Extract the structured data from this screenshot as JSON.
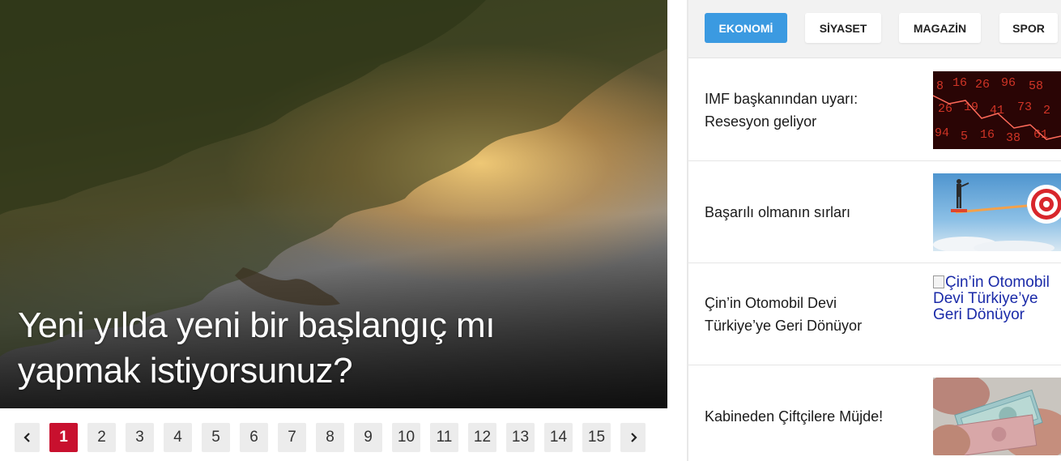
{
  "slider": {
    "headline": "Yeni yılda yeni bir başlangıç mı yapmak istiyorsunuz?",
    "pages": [
      "1",
      "2",
      "3",
      "4",
      "5",
      "6",
      "7",
      "8",
      "9",
      "10",
      "11",
      "12",
      "13",
      "14",
      "15"
    ],
    "active_page": "1",
    "prev_icon": "chevron-left-icon",
    "next_icon": "chevron-right-icon"
  },
  "tabs": [
    "EKONOMİ",
    "SİYASET",
    "MAGAZİN",
    "SPOR"
  ],
  "active_tab": "EKONOMİ",
  "news": [
    {
      "title": "IMF başkanından uyarı: Resesyon geliyor"
    },
    {
      "title": "Başarılı olmanın sırları"
    },
    {
      "title": "Çin’in Otomobil Devi Türkiye’ye Geri Dönüyor",
      "image_alt": "Çin’in Otomobil Devi Türkiye’ye Geri Dönüyor"
    },
    {
      "title": "Kabineden Çiftçilere Müjde!"
    }
  ],
  "colors": {
    "accent_tab": "#3b9ae1",
    "active_page": "#c8102e"
  }
}
